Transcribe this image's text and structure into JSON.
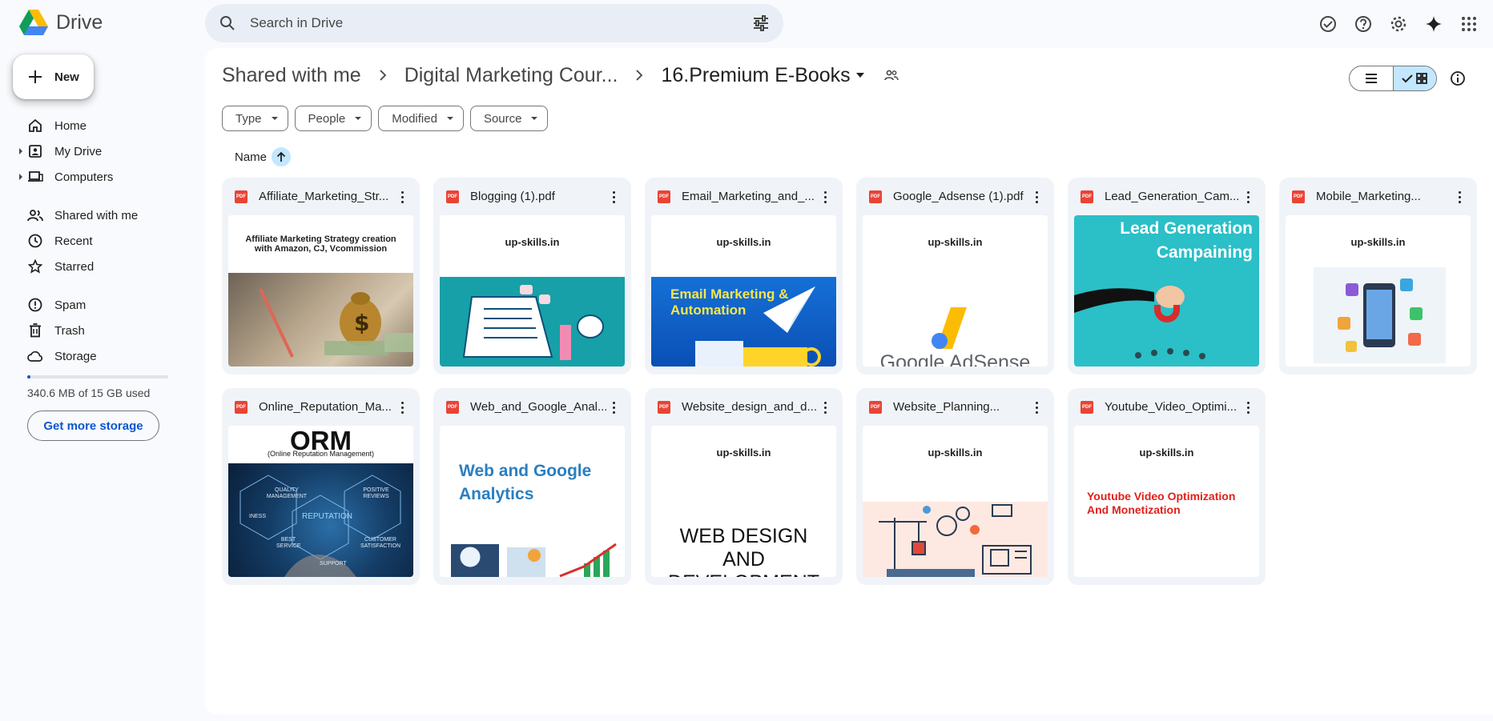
{
  "app": {
    "name": "Drive"
  },
  "search": {
    "placeholder": "Search in Drive"
  },
  "sidebar": {
    "new_label": "New",
    "items": [
      {
        "label": "Home",
        "icon": "home-icon"
      },
      {
        "label": "My Drive",
        "icon": "my-drive-icon"
      },
      {
        "label": "Computers",
        "icon": "computers-icon"
      },
      {
        "label": "Shared with me",
        "icon": "shared-icon"
      },
      {
        "label": "Recent",
        "icon": "recent-icon"
      },
      {
        "label": "Starred",
        "icon": "star-icon"
      },
      {
        "label": "Spam",
        "icon": "spam-icon"
      },
      {
        "label": "Trash",
        "icon": "trash-icon"
      },
      {
        "label": "Storage",
        "icon": "cloud-icon"
      }
    ],
    "storage_used_fraction": 0.023,
    "storage_text": "340.6 MB of 15 GB used",
    "get_storage_label": "Get more storage"
  },
  "breadcrumb": {
    "root": "Shared with me",
    "middle": "Digital Marketing Cour...",
    "current": "16.Premium E-Books"
  },
  "filters": [
    {
      "label": "Type"
    },
    {
      "label": "People"
    },
    {
      "label": "Modified"
    },
    {
      "label": "Source"
    }
  ],
  "sort": {
    "label": "Name"
  },
  "files": [
    {
      "name": "Affiliate_Marketing_Str...",
      "thumb_title": "Affiliate Marketing Strategy creation with Amazon, CJ, Vcommission"
    },
    {
      "name": "Blogging (1).pdf",
      "thumb_title": "up-skills.in"
    },
    {
      "name": "Email_Marketing_and_...",
      "thumb_title": "up-skills.in",
      "thumb_text": "Email Marketing & Automation"
    },
    {
      "name": "Google_Adsense (1).pdf",
      "thumb_title": "up-skills.in",
      "thumb_text": "Google AdSense"
    },
    {
      "name": "Lead_Generation_Cam...",
      "thumb_text": "Lead Generation Campaining"
    },
    {
      "name": "Mobile_Marketing...",
      "thumb_title": "up-skills.in"
    },
    {
      "name": "Online_Reputation_Ma...",
      "thumb_text": "ORM",
      "thumb_sub": "(Online Reputation Management)",
      "thumb_words": [
        "QUALITY MANAGEMENT",
        "POSITIVE REVIEWS",
        "INESS",
        "REPUTATION",
        "BEST SERVICE",
        "CUSTOMER SATISFACTION",
        "SUPPORT"
      ]
    },
    {
      "name": "Web_and_Google_Anal...",
      "thumb_text": "Web and Google Analytics"
    },
    {
      "name": "Website_design_and_d...",
      "thumb_title": "up-skills.in",
      "thumb_text": "WEB DESIGN AND DEVELOPMENT"
    },
    {
      "name": "Website_Planning...",
      "thumb_title": "up-skills.in"
    },
    {
      "name": "Youtube_Video_Optimi...",
      "thumb_title": "up-skills.in",
      "thumb_text": "Youtube Video Optimization And Monetization"
    }
  ],
  "colors": {
    "accent": "#0b57d0",
    "selected": "#c2e7ff",
    "pdf": "#ea4335",
    "card": "#f0f4f9"
  }
}
